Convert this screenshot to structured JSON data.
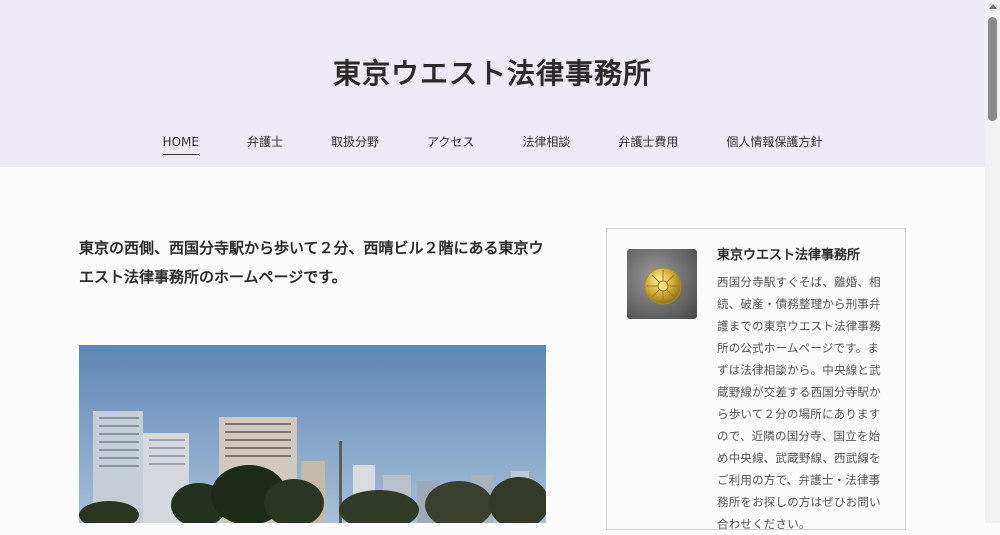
{
  "site": {
    "title": "東京ウエスト法律事務所"
  },
  "nav": {
    "items": [
      {
        "label": "HOME"
      },
      {
        "label": "弁護士"
      },
      {
        "label": "取扱分野"
      },
      {
        "label": "アクセス"
      },
      {
        "label": "法律相談"
      },
      {
        "label": "弁護士費用"
      },
      {
        "label": "個人情報保護方針"
      }
    ],
    "active_index": 0
  },
  "main": {
    "intro": "東京の西側、西国分寺駅から歩いて２分、西晴ビル２階にある東京ウエスト法律事務所のホームページです。"
  },
  "sidebar": {
    "title": "東京ウエスト法律事務所",
    "description": "西国分寺駅すぐそば、離婚、相続、破産・債務整理から刑事弁護までの東京ウエスト法律事務所の公式ホームページです。まずは法律相談から。中央線と武蔵野線が交差する西国分寺駅から歩いて２分の場所にありますので、近隣の国分寺、国立を始め中央線、武蔵野線、西武線をご利用の方で、弁護士・法律事務所をお探しの方はぜひお問い合わせください。"
  },
  "colors": {
    "header_bg": "#eeeaf3",
    "page_bg": "#fbfbfc",
    "text": "#2b2b2b"
  }
}
